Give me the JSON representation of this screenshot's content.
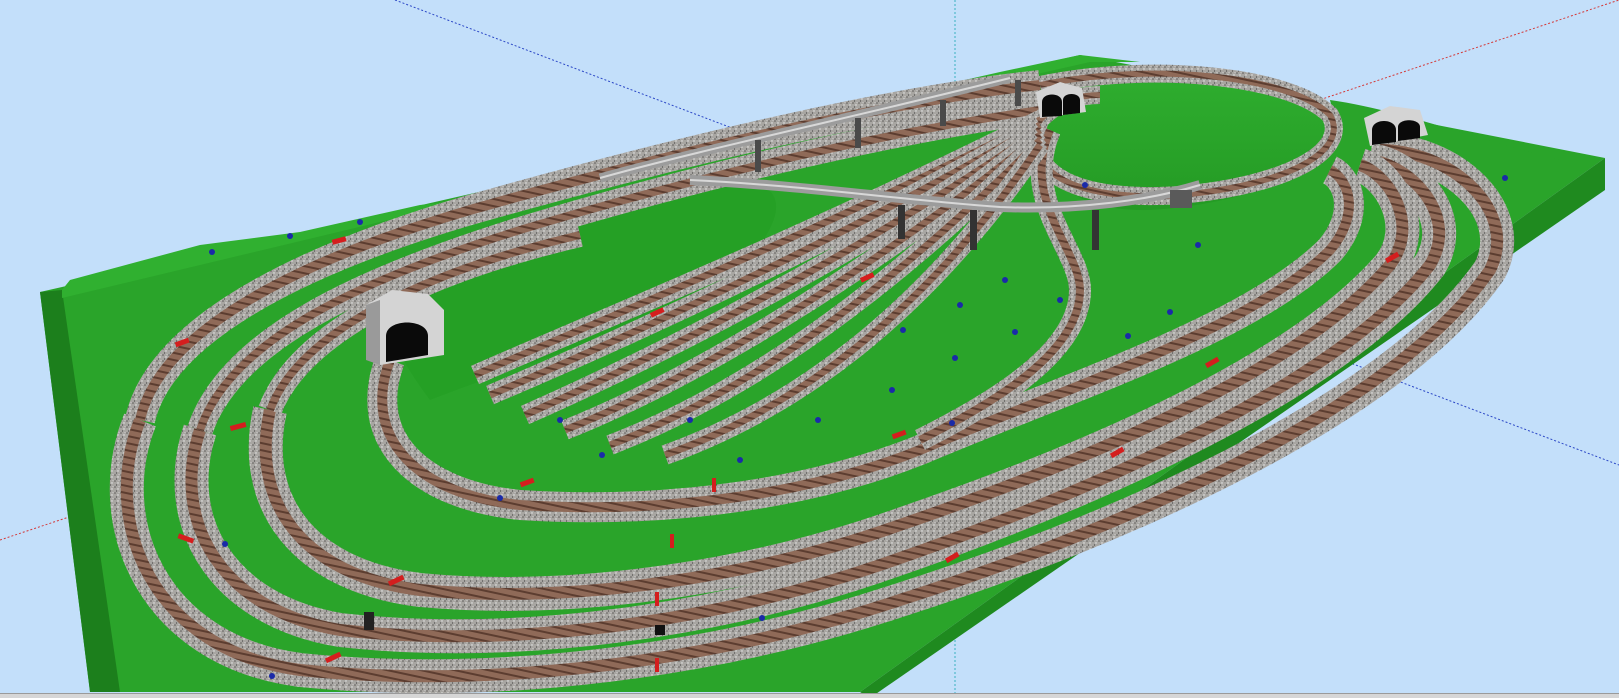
{
  "window": {
    "view": "3D layout view"
  },
  "colors": {
    "sky": "#c3dffa",
    "grass": "#2aa42a",
    "grass_dark": "#1f8a1f",
    "grass_edge": "#178017",
    "ballast": "#a9a7a3",
    "ballast_dark": "#7f7d7a",
    "rail": "#6e4e3a",
    "sleeper": "#8a5a45",
    "marker": "#d41e1e",
    "signal": "#1a2aa8",
    "tunnel_portal": "#cfcfcf",
    "tunnel_hole": "#0a0a0a",
    "viaduct": "#9a9a9a",
    "axis_x": "#d43a3a",
    "axis_y": "#2b47c6",
    "axis_z": "#3ab0c0"
  },
  "scene": {
    "objects": [
      "baseboard",
      "hill",
      "track-loop",
      "yard-sidings",
      "viaduct",
      "tunnel-portal-left",
      "tunnel-portal-top",
      "tunnel-portal-right"
    ]
  }
}
